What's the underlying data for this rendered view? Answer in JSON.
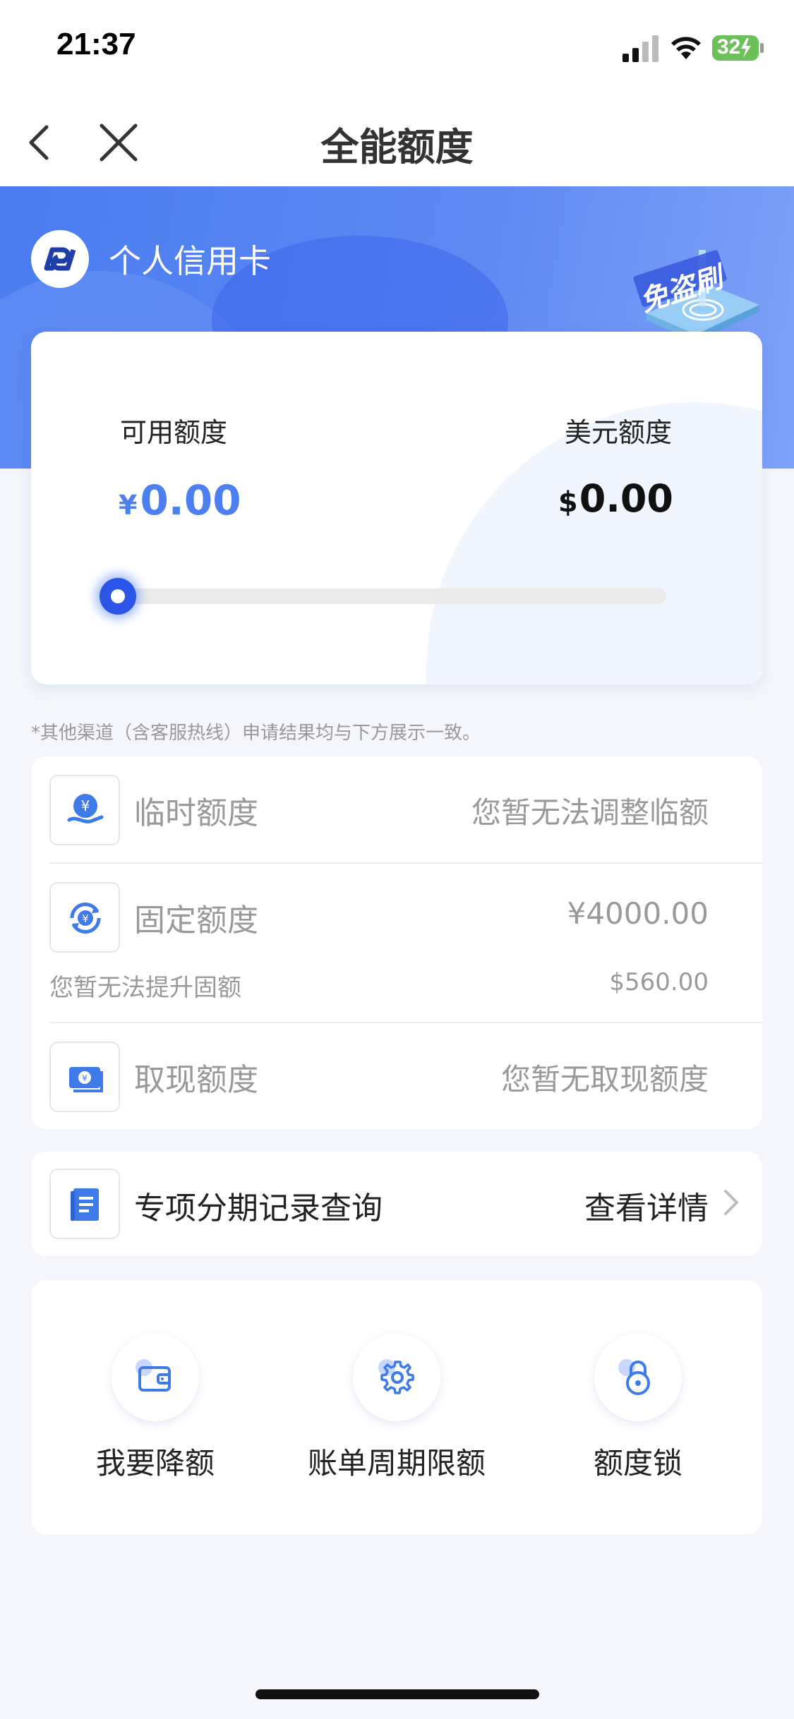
{
  "status_bar": {
    "time": "21:37",
    "battery": "32",
    "signal_icon": "signal-icon",
    "wifi_icon": "wifi-icon",
    "battery_icon": "battery-charging-icon"
  },
  "nav": {
    "title": "全能额度",
    "back_icon": "chevron-left-icon",
    "close_icon": "close-icon"
  },
  "header": {
    "card_type": "个人信用卡",
    "badge_text": "免盗刷",
    "logo_icon": "bank-logo"
  },
  "limit_card": {
    "available_label": "可用额度",
    "available_currency": "¥",
    "available_value": "0.00",
    "usd_label": "美元额度",
    "usd_currency": "$",
    "usd_value": "0.00",
    "usage_fraction": 0.0
  },
  "note": "*其他渠道（含客服热线）申请结果均与下方展示一致。",
  "limit_list": {
    "temporary": {
      "title": "临时额度",
      "value": "您暂无法调整临额",
      "icon": "hand-yuan-icon"
    },
    "fixed": {
      "title": "固定额度",
      "value": "¥4000.00",
      "sub_left": "您暂无法提升固额",
      "sub_right": "$560.00",
      "icon": "yuan-cycle-icon"
    },
    "cash": {
      "title": "取现额度",
      "value": "您暂无取现额度",
      "icon": "cash-note-icon"
    }
  },
  "installment": {
    "title": "专项分期记录查询",
    "link": "查看详情",
    "icon": "document-list-icon"
  },
  "actions": [
    {
      "label": "我要降额",
      "icon": "wallet-icon"
    },
    {
      "label": "账单周期限额",
      "icon": "gear-icon"
    },
    {
      "label": "额度锁",
      "icon": "lock-icon"
    }
  ],
  "colors": {
    "accent": "#4c7ff0",
    "header_blue": "#5d88f3",
    "background": "#f4f6fb"
  }
}
